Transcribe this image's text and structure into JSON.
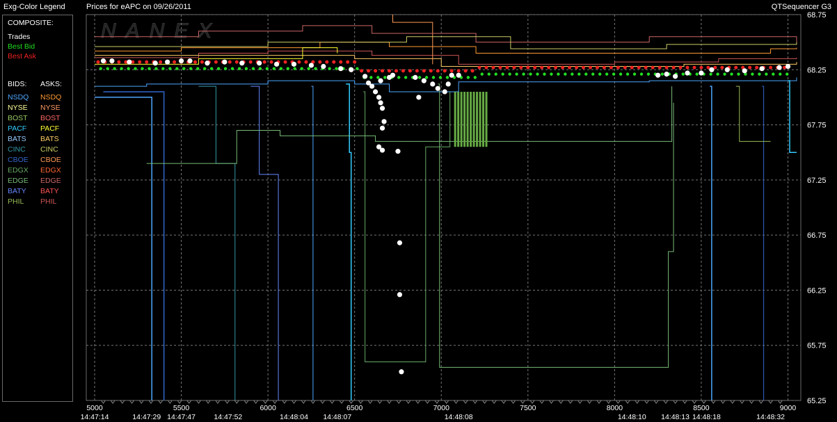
{
  "legend_title": "Exg-Color Legend",
  "chart_title": "Prices for  eAPC  on  09/26/2011",
  "app_name": "QTSequencer G3",
  "watermark": "NANEX",
  "composite": {
    "label": "COMPOSITE:",
    "items": [
      {
        "label": "Trades",
        "color": "#ffffff"
      },
      {
        "label": "Best Bid",
        "color": "#22dd22"
      },
      {
        "label": "Best Ask",
        "color": "#ee2222"
      }
    ]
  },
  "bids_label": "BIDS:",
  "asks_label": "ASKS:",
  "exchanges": [
    {
      "bid": "NSDQ",
      "bid_color": "#4da6ff",
      "ask": "NSDQ",
      "ask_color": "#ff9933"
    },
    {
      "bid": "NYSE",
      "bid_color": "#ffff99",
      "ask": "NYSE",
      "ask_color": "#ff9966"
    },
    {
      "bid": "BOST",
      "bid_color": "#99cc66",
      "ask": "BOST",
      "ask_color": "#ff6666"
    },
    {
      "bid": "PACF",
      "bid_color": "#33ccff",
      "ask": "PACF",
      "ask_color": "#ffff33"
    },
    {
      "bid": "BATS",
      "bid_color": "#99ccff",
      "ask": "BATS",
      "ask_color": "#ffcc66"
    },
    {
      "bid": "CINC",
      "bid_color": "#3399aa",
      "ask": "CINC",
      "ask_color": "#cccc66"
    },
    {
      "bid": "CBOE",
      "bid_color": "#3366cc",
      "ask": "CBOE",
      "ask_color": "#ff9955"
    },
    {
      "bid": "EDGX",
      "bid_color": "#66aa66",
      "ask": "EDGX",
      "ask_color": "#ff6633"
    },
    {
      "bid": "EDGE",
      "bid_color": "#77bb77",
      "ask": "EDGE",
      "ask_color": "#cc6666"
    },
    {
      "bid": "BATY",
      "bid_color": "#6688ff",
      "ask": "BATY",
      "ask_color": "#ff5555"
    },
    {
      "bid": "PHIL",
      "bid_color": "#99bb55",
      "ask": "PHIL",
      "ask_color": "#cc5555"
    }
  ],
  "chart_data": {
    "type": "scatter",
    "title": "Prices for  eAPC  on  09/26/2011",
    "xlabel": "",
    "ylabel": "",
    "xlim": [
      5000,
      9050
    ],
    "ylim": [
      65.25,
      68.75
    ],
    "y_ticks": [
      "68.75",
      "68.25",
      "67.75",
      "67.25",
      "66.75",
      "66.25",
      "65.75",
      "65.25"
    ],
    "x_ticks": [
      "5000",
      "5500",
      "6000",
      "6500",
      "7000",
      "7500",
      "8000",
      "8500",
      "9000"
    ],
    "time_labels": [
      {
        "x": 5000,
        "label": "14:47:14"
      },
      {
        "x": 5300,
        "label": "14:47:29"
      },
      {
        "x": 5500,
        "label": "14:47:47"
      },
      {
        "x": 5770,
        "label": "14:47:52"
      },
      {
        "x": 6150,
        "label": "14:48:04"
      },
      {
        "x": 6400,
        "label": "14:48:07"
      },
      {
        "x": 7100,
        "label": "14:48:08"
      },
      {
        "x": 8100,
        "label": "14:48:10"
      },
      {
        "x": 8350,
        "label": "14:48:13"
      },
      {
        "x": 8530,
        "label": "14:48:18"
      },
      {
        "x": 8900,
        "label": "14:48:32"
      }
    ],
    "grid": true,
    "trades": [
      [
        5050,
        68.33
      ],
      [
        5100,
        68.33
      ],
      [
        5200,
        68.32
      ],
      [
        5350,
        68.31
      ],
      [
        5420,
        68.32
      ],
      [
        5500,
        68.33
      ],
      [
        5550,
        68.33
      ],
      [
        5650,
        68.31
      ],
      [
        5750,
        68.32
      ],
      [
        5850,
        68.31
      ],
      [
        5950,
        68.31
      ],
      [
        6050,
        68.3
      ],
      [
        6150,
        68.3
      ],
      [
        6250,
        68.29
      ],
      [
        6320,
        68.28
      ],
      [
        6420,
        68.26
      ],
      [
        6480,
        68.25
      ],
      [
        6560,
        68.19
      ],
      [
        6580,
        68.13
      ],
      [
        6600,
        68.1
      ],
      [
        6620,
        68.05
      ],
      [
        6640,
        68.0
      ],
      [
        6650,
        67.95
      ],
      [
        6660,
        67.9
      ],
      [
        6670,
        67.78
      ],
      [
        6660,
        67.72
      ],
      [
        6640,
        67.55
      ],
      [
        6660,
        67.52
      ],
      [
        6750,
        67.51
      ],
      [
        6650,
        68.15
      ],
      [
        6700,
        68.18
      ],
      [
        6720,
        68.2
      ],
      [
        6760,
        66.68
      ],
      [
        6760,
        66.21
      ],
      [
        6770,
        65.51
      ],
      [
        6850,
        68.18
      ],
      [
        6870,
        68.0
      ],
      [
        6900,
        68.15
      ],
      [
        6950,
        68.12
      ],
      [
        6980,
        68.08
      ],
      [
        7020,
        68.05
      ],
      [
        7040,
        68.12
      ],
      [
        7060,
        68.2
      ],
      [
        7100,
        68.2
      ],
      [
        8250,
        68.2
      ],
      [
        8300,
        68.21
      ],
      [
        8350,
        68.19
      ],
      [
        8420,
        68.22
      ],
      [
        8500,
        68.22
      ],
      [
        8560,
        68.25
      ],
      [
        8650,
        68.25
      ],
      [
        8750,
        68.24
      ],
      [
        8850,
        68.26
      ],
      [
        8950,
        68.27
      ],
      [
        9000,
        68.28
      ]
    ]
  }
}
